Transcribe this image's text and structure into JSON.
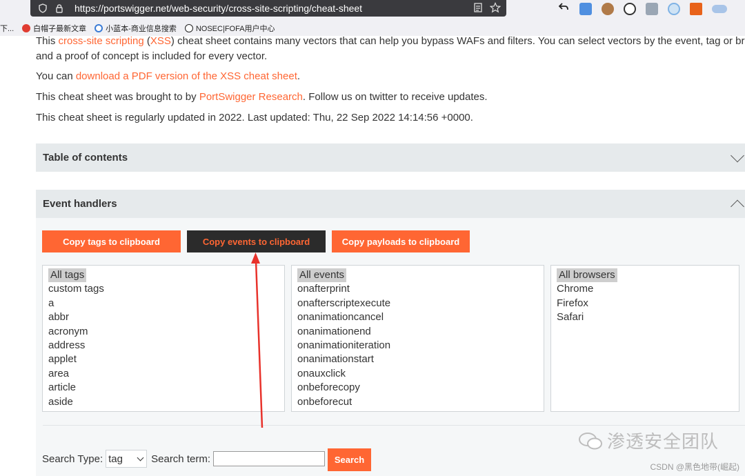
{
  "browser": {
    "url": "https://portswigger.net/web-security/cross-site-scripting/cheat-sheet",
    "bookmarks": [
      "下...",
      "白帽子最新文章",
      "小蓝本-商业信息搜索",
      "NOSEC|FOFA用户中心"
    ]
  },
  "intro": {
    "line1_pre": "This ",
    "line1_link1": "cross-site scripting",
    "line1_mid": " (",
    "line1_link2": "XSS",
    "line1_post": ") cheat sheet contains many vectors that can help you bypass WAFs and filters. You can select vectors by the event, tag or browser",
    "line2": "and a proof of concept is included for every vector.",
    "line3_pre": "You can ",
    "line3_link": "download a PDF version of the XSS cheat sheet",
    "line3_post": ".",
    "line4_pre": "This cheat sheet was brought to by ",
    "line4_link": "PortSwigger Research",
    "line4_post": ". Follow us on twitter to receive updates.",
    "line5": "This cheat sheet is regularly updated in 2022. Last updated: Thu, 22 Sep 2022 14:14:56 +0000."
  },
  "toc": {
    "title": "Table of contents"
  },
  "events_section": {
    "title": "Event handlers",
    "copy_tags_label": "Copy tags to clipboard",
    "copy_events_label": "Copy events to clipboard",
    "copy_payloads_label": "Copy payloads to clipboard",
    "tags": [
      "All tags",
      "custom tags",
      "a",
      "abbr",
      "acronym",
      "address",
      "applet",
      "area",
      "article",
      "aside"
    ],
    "events": [
      "All events",
      "onafterprint",
      "onafterscriptexecute",
      "onanimationcancel",
      "onanimationend",
      "onanimationiteration",
      "onanimationstart",
      "onauxclick",
      "onbeforecopy",
      "onbeforecut"
    ],
    "browsers": [
      "All browsers",
      "Chrome",
      "Firefox",
      "Safari"
    ]
  },
  "search": {
    "type_label": "Search Type:",
    "type_value": "tag",
    "term_label": "Search term:",
    "term_value": "",
    "button_label": "Search"
  },
  "watermark": {
    "text": "渗透安全团队",
    "csdn": "CSDN @黑色地带(崛起)"
  },
  "colors": {
    "accent": "#ff6633",
    "dark_button": "#2b2b2b",
    "panel": "#e6eaec"
  }
}
